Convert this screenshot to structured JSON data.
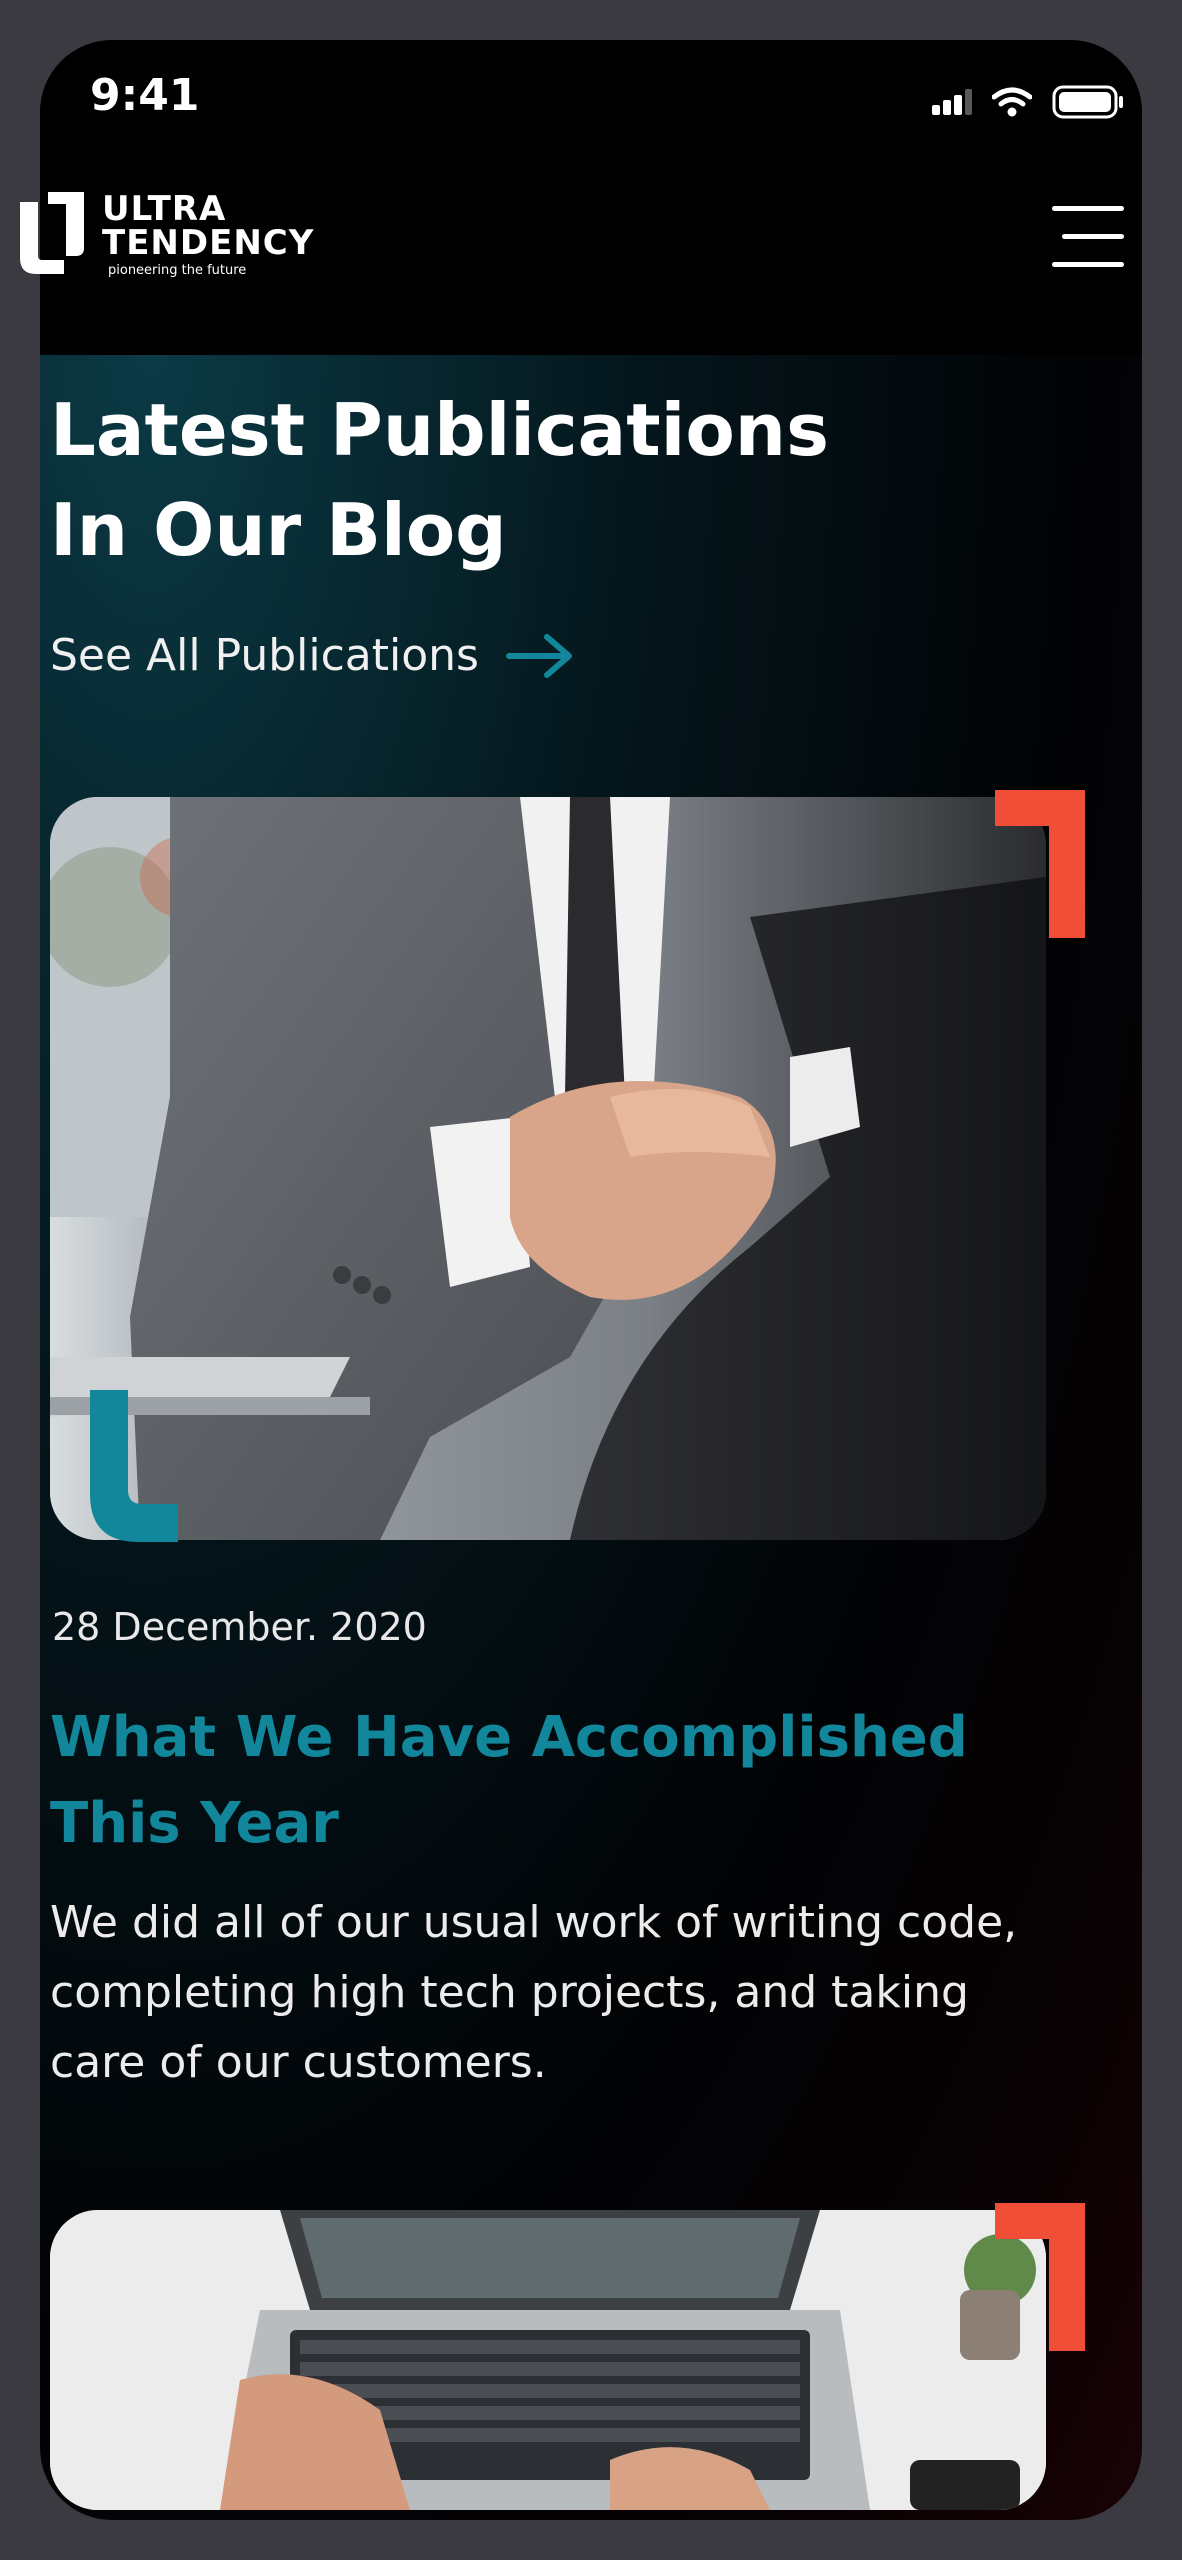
{
  "status_bar": {
    "time": "9:41",
    "icons": [
      "signal-icon",
      "wifi-icon",
      "battery-icon"
    ]
  },
  "header": {
    "logo": {
      "line1": "ULTRA",
      "line2": "TENDENCY",
      "tagline": "pioneering the future"
    },
    "menu_icon": "hamburger-menu-icon"
  },
  "hero": {
    "title_line1": "Latest Publications",
    "title_line2": "In Our Blog",
    "see_all_label": "See All Publications",
    "see_all_icon": "arrow-right-icon"
  },
  "posts": [
    {
      "image": "business-handshake-photo",
      "date": "28 December. 2020",
      "title_line1": "What We Have Accomplished",
      "title_line2": "This Year",
      "excerpt": "We did all of our usual work of writing code, completing high tech projects, and taking care of our customers."
    },
    {
      "image": "laptop-typing-photo"
    }
  ],
  "colors": {
    "accent_teal": "#12879b",
    "accent_red": "#f04e37",
    "background": "#020305",
    "text": "#ffffff"
  }
}
